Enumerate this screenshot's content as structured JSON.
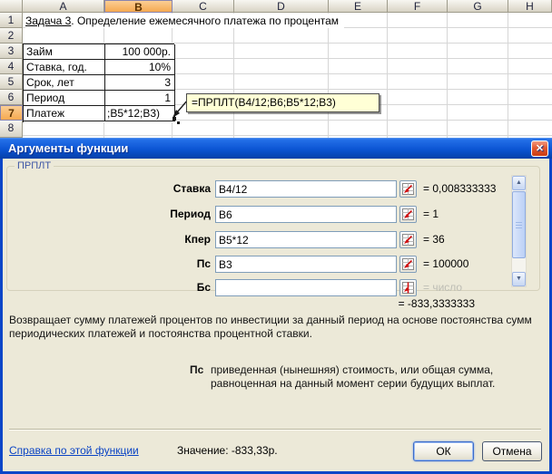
{
  "icons": {
    "close": "✕",
    "scroll_up": "▲",
    "scroll_down": "▼"
  },
  "sheet": {
    "column_headers": [
      "A",
      "B",
      "C",
      "D",
      "E",
      "F",
      "G",
      "H"
    ],
    "row_headers": [
      "1",
      "2",
      "3",
      "4",
      "5",
      "6",
      "7",
      "8"
    ],
    "selected_column": "B",
    "selected_row": "7",
    "title_underlined": "Задача 3",
    "title_rest": ". Определение ежемесячного платежа по процентам",
    "items": [
      {
        "label": "Займ",
        "value": "100 000р."
      },
      {
        "label": "Ставка, год.",
        "value": "10%"
      },
      {
        "label": "Срок, лет",
        "value": "3"
      },
      {
        "label": "Период",
        "value": "1"
      },
      {
        "label": "Платеж",
        "value": ";B5*12;B3)"
      }
    ],
    "formula_tooltip": "=ПРПЛТ(B4/12;B6;B5*12;B3)"
  },
  "dialog": {
    "title": "Аргументы функции",
    "function_name": "ПРПЛТ",
    "fields": [
      {
        "label": "Ставка",
        "value": "B4/12",
        "result": "= 0,008333333"
      },
      {
        "label": "Период",
        "value": "B6",
        "result": "= 1"
      },
      {
        "label": "Кпер",
        "value": "B5*12",
        "result": "= 36"
      },
      {
        "label": "Пс",
        "value": "B3",
        "result": "= 100000"
      },
      {
        "label": "Бс",
        "value": "",
        "result": "= число"
      }
    ],
    "formula_result": "= -833,3333333",
    "description": "Возвращает сумму платежей процентов по инвестиции за данный период на основе постоянства сумм периодических платежей и постоянства процентной ставки.",
    "arg_name": "Пс",
    "arg_description": "приведенная (нынешняя) стоимость, или общая сумма, равноценная на данный момент серии будущих выплат.",
    "help_link": "Справка по этой функции",
    "value_text": "Значение: -833,33р.",
    "ok_label": "ОК",
    "cancel_label": "Отмена",
    "colors": {
      "title_blue": "#0C55D4",
      "body": "#ECE9D8",
      "close_red": "#C83A12",
      "link": "#0B44C4"
    }
  }
}
